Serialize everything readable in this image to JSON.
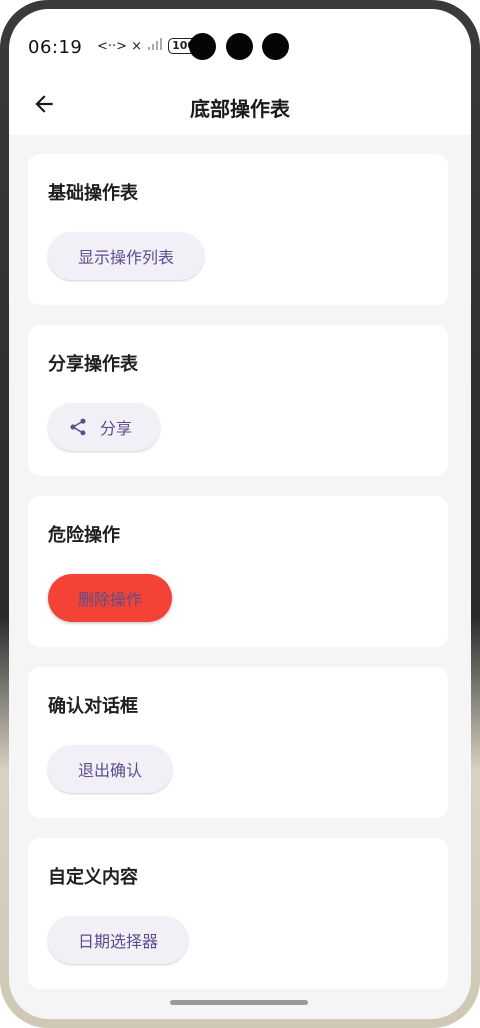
{
  "status_bar": {
    "time": "06:19",
    "network_icons": "<··> ×",
    "battery": "100"
  },
  "app_bar": {
    "title": "底部操作表",
    "back_icon": "arrow-back-icon"
  },
  "sections": [
    {
      "title": "基础操作表",
      "button_label": "显示操作列表"
    },
    {
      "title": "分享操作表",
      "button_label": "分享",
      "button_icon": "share-icon"
    },
    {
      "title": "危险操作",
      "button_label": "删除操作",
      "button_color": "#f44336"
    },
    {
      "title": "确认对话框",
      "button_label": "退出确认"
    },
    {
      "title": "自定义内容",
      "button_label": "日期选择器"
    }
  ],
  "colors": {
    "background": "#f5f5f5",
    "card": "#ffffff",
    "button_bg": "#f3eff7",
    "button_text": "#5b4e8c",
    "danger": "#f44336"
  }
}
